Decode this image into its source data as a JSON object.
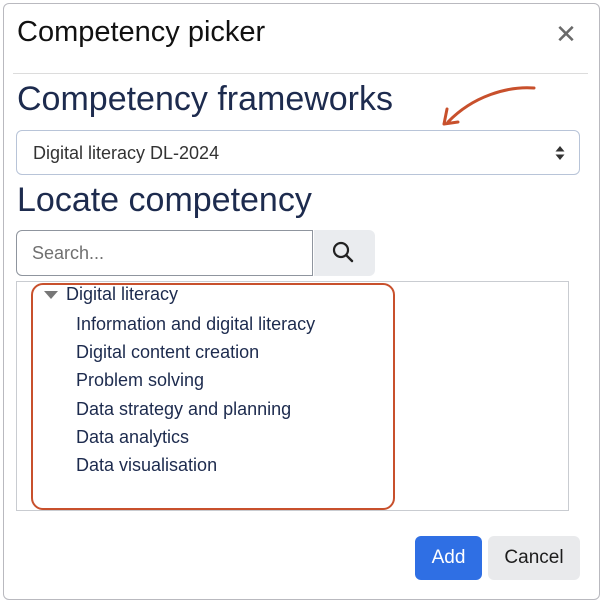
{
  "dialog": {
    "title": "Competency picker",
    "close_icon": "close-icon"
  },
  "frameworks": {
    "heading": "Competency frameworks",
    "selected": "Digital literacy DL-2024"
  },
  "locate": {
    "heading": "Locate competency",
    "search_placeholder": "Search...",
    "search_icon": "search-icon"
  },
  "tree": {
    "root": "Digital literacy",
    "children": [
      "Information and digital literacy",
      "Digital content creation",
      "Problem solving",
      "Data strategy and planning",
      "Data analytics",
      "Data visualisation"
    ]
  },
  "footer": {
    "add_label": "Add",
    "cancel_label": "Cancel"
  },
  "colors": {
    "primary": "#2f6fe4",
    "annotation": "#c8502c",
    "heading": "#1d2b4e"
  }
}
